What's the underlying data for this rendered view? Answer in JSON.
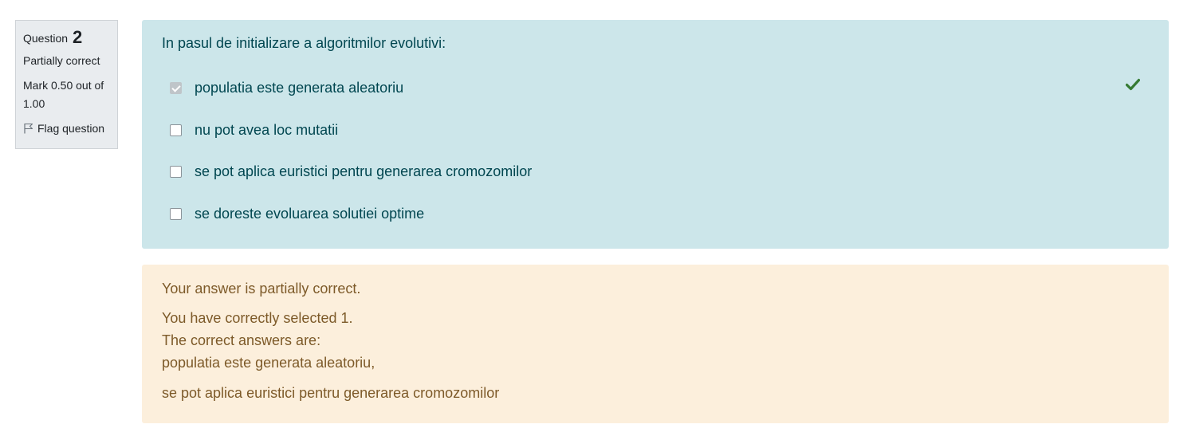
{
  "info": {
    "question_label": "Question",
    "question_number": "2",
    "state": "Partially correct",
    "grade": "Mark 0.50 out of 1.00",
    "flag_label": "Flag question",
    "flag_icon": "flag-icon"
  },
  "question": {
    "text": "In pasul de initializare a algoritmilor evolutivi:",
    "answers": [
      {
        "label": "populatia este generata aleatoriu",
        "checked": true,
        "mark": "correct"
      },
      {
        "label": "nu pot avea loc mutatii",
        "checked": false
      },
      {
        "label": "se pot aplica euristici pentru generarea cromozomilor",
        "checked": false
      },
      {
        "label": "se doreste evoluarea solutiei optime",
        "checked": false
      }
    ],
    "correct_icon": "check-icon"
  },
  "feedback": {
    "summary": "Your answer is partially correct.",
    "selected_count": "You have correctly selected 1.",
    "correct_header": "The correct answers are:",
    "correct_answers": [
      "populatia este generata aleatoriu,",
      "se pot aplica euristici pentru generarea cromozomilor"
    ]
  },
  "colors": {
    "formulation_bg": "#cce6ea",
    "formulation_text": "#004650",
    "feedback_bg": "#fcefdc",
    "feedback_text": "#7d5a29",
    "correct_green": "#357a32",
    "info_bg": "#e9ecef"
  }
}
